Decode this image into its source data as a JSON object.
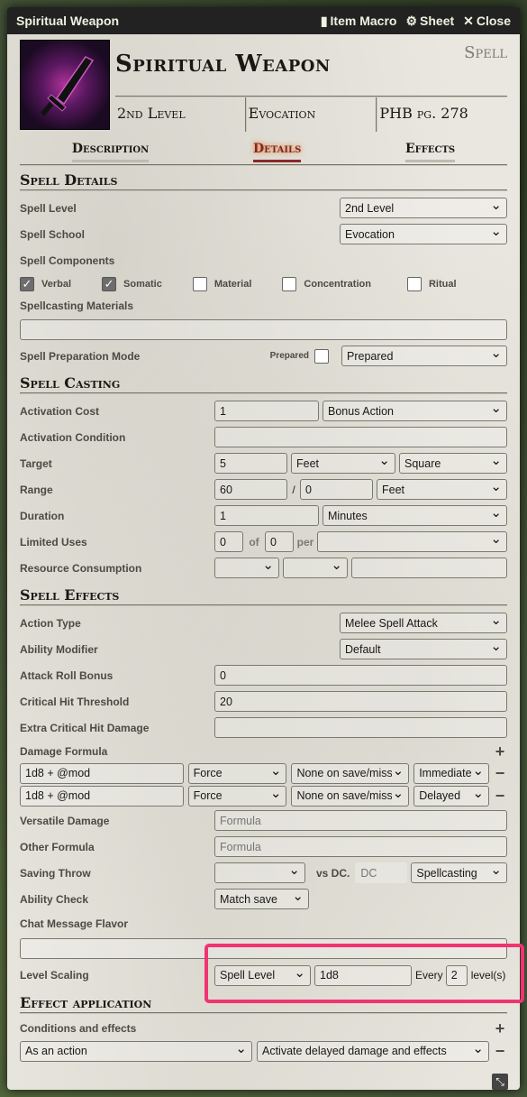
{
  "window": {
    "title": "Spiritual Weapon",
    "item_macro": "Item Macro",
    "sheet": "Sheet",
    "close": "Close"
  },
  "header": {
    "name": "Spiritual Weapon",
    "type": "Spell",
    "level": "2nd Level",
    "school": "Evocation",
    "source": "PHB pg. 278"
  },
  "tabs": [
    "Description",
    "Details",
    "Effects"
  ],
  "spell_details": {
    "title": "Spell Details",
    "level_label": "Spell Level",
    "level_value": "2nd Level",
    "school_label": "Spell School",
    "school_value": "Evocation",
    "components_label": "Spell Components",
    "components": [
      {
        "label": "Verbal",
        "checked": true
      },
      {
        "label": "Somatic",
        "checked": true
      },
      {
        "label": "Material",
        "checked": false
      },
      {
        "label": "Concentration",
        "checked": false
      },
      {
        "label": "Ritual",
        "checked": false
      }
    ],
    "materials_label": "Spellcasting Materials",
    "materials_value": "",
    "prep_label": "Spell Preparation Mode",
    "prepared_label": "Prepared",
    "prep_value": "Prepared"
  },
  "spell_casting": {
    "title": "Spell Casting",
    "activation_label": "Activation Cost",
    "activation_cost": "1",
    "activation_type": "Bonus Action",
    "condition_label": "Activation Condition",
    "condition_value": "",
    "target_label": "Target",
    "target_value": "5",
    "target_units": "Feet",
    "target_type": "Square",
    "range_label": "Range",
    "range_value": "60",
    "range_sep": "/",
    "range_long": "0",
    "range_units": "Feet",
    "duration_label": "Duration",
    "duration_value": "1",
    "duration_units": "Minutes",
    "uses_label": "Limited Uses",
    "uses_value": "0",
    "uses_of": "of",
    "uses_max": "0",
    "uses_per": "per",
    "uses_period": "",
    "resource_label": "Resource Consumption"
  },
  "spell_effects": {
    "title": "Spell Effects",
    "action_label": "Action Type",
    "action_value": "Melee Spell Attack",
    "ability_label": "Ability Modifier",
    "ability_value": "Default",
    "attack_bonus_label": "Attack Roll Bonus",
    "attack_bonus_value": "0",
    "crit_label": "Critical Hit Threshold",
    "crit_value": "20",
    "extra_crit_label": "Extra Critical Hit Damage",
    "extra_crit_value": "",
    "damage_label": "Damage Formula",
    "damage_rows": [
      {
        "formula": "1d8 + @mod",
        "type": "Force",
        "save": "None on save/miss",
        "timing": "Immediate"
      },
      {
        "formula": "1d8 + @mod",
        "type": "Force",
        "save": "None on save/miss",
        "timing": "Delayed"
      }
    ],
    "versatile_label": "Versatile Damage",
    "versatile_placeholder": "Formula",
    "other_label": "Other Formula",
    "other_placeholder": "Formula",
    "save_label": "Saving Throw",
    "save_value": "",
    "vs_dc": "vs DC.",
    "dc_placeholder": "DC",
    "dc_mode": "Spellcasting",
    "check_label": "Ability Check",
    "check_value": "Match save",
    "flavor_label": "Chat Message Flavor",
    "flavor_value": "",
    "scaling_label": "Level Scaling",
    "scaling_mode": "Spell Level",
    "scaling_formula": "1d8",
    "scaling_every": "Every",
    "scaling_step": "2",
    "scaling_levels": "level(s)"
  },
  "effect_application": {
    "title": "Effect application",
    "conditions_label": "Conditions and effects",
    "trigger": "As an action",
    "action": "Activate delayed damage and effects"
  },
  "colors": {
    "highlight": "#f03472",
    "active_tab": "#8a2a2a"
  }
}
